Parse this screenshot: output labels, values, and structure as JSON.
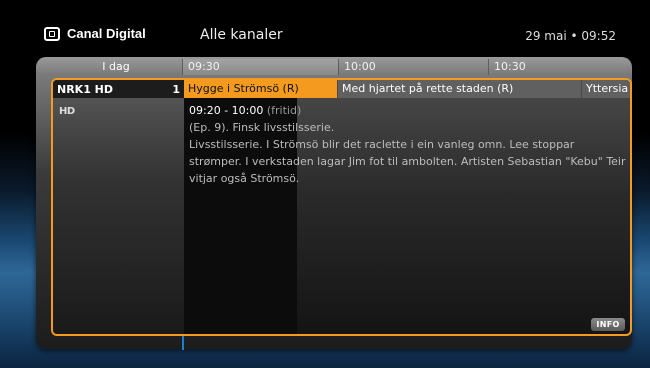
{
  "header": {
    "brand": "Canal Digital",
    "brand_icon": "tv-icon",
    "title": "Alle kanaler",
    "date": "29 mai",
    "separator": "•",
    "time": "09:52"
  },
  "timebar": {
    "day_label": "I dag",
    "slots": [
      "09:30",
      "10:00",
      "10:30"
    ]
  },
  "channel": {
    "name": "NRK1 HD",
    "number": "1",
    "badge": "HD"
  },
  "programs": [
    {
      "title": "Hygge i Strömsö (R)",
      "selected": true
    },
    {
      "title": "Med hjartet på rette staden (R)",
      "selected": false
    },
    {
      "title": "Yttersia",
      "selected": false
    }
  ],
  "details": {
    "time_range": "09:20 - 10:00",
    "category": "(fritid)",
    "subtitle": "(Ep. 9).  Finsk livsstilsserie.",
    "description": "Livsstilsserie. I Strömsö blir det raclette i ein vanleg omn. Lee stoppar strømper. I verkstaden lagar Jim fot til ambolten. Artisten Sebastian \"Kebu\" Teir vitjar også Strömsö."
  },
  "info_button": "INFO",
  "colors": {
    "accent": "#f39a1f",
    "cursor": "#1d7dd0"
  }
}
